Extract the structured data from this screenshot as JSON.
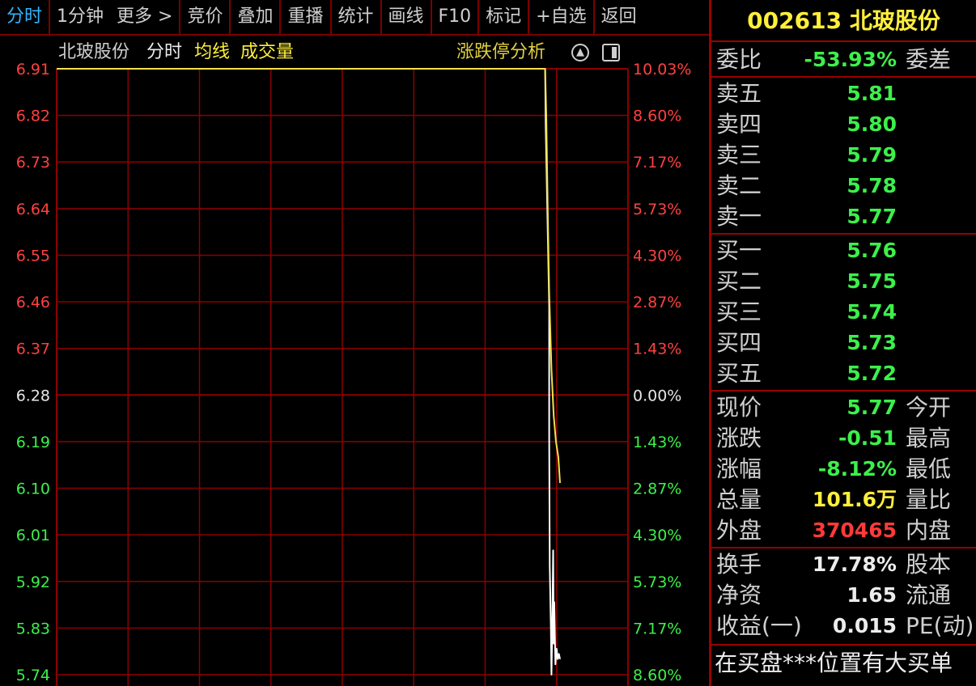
{
  "toolbar": {
    "tabs": [
      "分时",
      "1分钟",
      "更多 >",
      "竞价",
      "叠加",
      "重播",
      "统计",
      "画线",
      "F10",
      "标记",
      "+自选",
      "返回"
    ]
  },
  "chart": {
    "header": {
      "stock_name": "北玻股份",
      "mode": "分时",
      "avg_line": "均线",
      "volume": "成交量",
      "analysis": "涨跌停分析"
    },
    "colors": {
      "grid": "#8b0000",
      "price": "#ffffff",
      "avg": "#f2e24a",
      "up": "#ff4040",
      "flat": "#e6e6e6",
      "down": "#3cf04a"
    }
  },
  "chart_data": {
    "type": "line",
    "y_ticks_left": [
      "6.91",
      "6.82",
      "6.73",
      "6.64",
      "6.55",
      "6.46",
      "6.37",
      "6.28",
      "6.19",
      "6.10",
      "6.01",
      "5.92",
      "5.83",
      "5.74"
    ],
    "y_ticks_right": [
      "10.03%",
      "8.60%",
      "7.17%",
      "5.73%",
      "4.30%",
      "2.87%",
      "1.43%",
      "0.00%",
      "1.43%",
      "2.87%",
      "4.30%",
      "5.73%",
      "7.17%",
      "8.60%"
    ],
    "ylim": [
      5.74,
      6.91
    ],
    "series": [
      {
        "name": "分时",
        "color": "#ffffff",
        "x": [
          0,
          0.855,
          0.856,
          0.862,
          0.862,
          0.863,
          0.865,
          0.866,
          0.867,
          0.868,
          0.869,
          0.87,
          0.871,
          0.873,
          0.875,
          0.877,
          0.879,
          0.881
        ],
        "y": [
          6.91,
          6.91,
          6.8,
          6.45,
          6.2,
          5.95,
          5.83,
          5.74,
          5.8,
          5.88,
          5.98,
          5.8,
          5.88,
          5.76,
          5.79,
          5.77,
          5.78,
          5.77
        ]
      },
      {
        "name": "均线",
        "color": "#f2e24a",
        "x": [
          0,
          0.855,
          0.857,
          0.86,
          0.862,
          0.866,
          0.87,
          0.874,
          0.878,
          0.881
        ],
        "y": [
          6.91,
          6.91,
          6.82,
          6.6,
          6.48,
          6.33,
          6.24,
          6.19,
          6.16,
          6.11
        ]
      }
    ]
  },
  "panel": {
    "title": "002613 北玻股份",
    "weibi_label": "委比",
    "weibi_value": "-53.93%",
    "weicha_label": "委差",
    "sells": [
      {
        "label": "卖五",
        "price": "5.81"
      },
      {
        "label": "卖四",
        "price": "5.80"
      },
      {
        "label": "卖三",
        "price": "5.79"
      },
      {
        "label": "卖二",
        "price": "5.78"
      },
      {
        "label": "卖一",
        "price": "5.77"
      }
    ],
    "buys": [
      {
        "label": "买一",
        "price": "5.76"
      },
      {
        "label": "买二",
        "price": "5.75"
      },
      {
        "label": "买三",
        "price": "5.74"
      },
      {
        "label": "买四",
        "price": "5.73"
      },
      {
        "label": "买五",
        "price": "5.72"
      }
    ],
    "quote": [
      {
        "label": "现价",
        "value": "5.77",
        "right": "今开"
      },
      {
        "label": "涨跌",
        "value": "-0.51",
        "right": "最高"
      },
      {
        "label": "涨幅",
        "value": "-8.12%",
        "right": "最低"
      },
      {
        "label": "总量",
        "value": "101.6万",
        "right": "量比"
      },
      {
        "label": "外盘",
        "value": "370465",
        "right": "内盘"
      }
    ],
    "finance": [
      {
        "label": "换手",
        "value": "17.78%",
        "right": "股本"
      },
      {
        "label": "净资",
        "value": "1.65",
        "right": "流通"
      },
      {
        "label": "收益(一)",
        "value": "0.015",
        "right": "PE(动)"
      }
    ],
    "news": "在买盘***位置有大买单"
  }
}
